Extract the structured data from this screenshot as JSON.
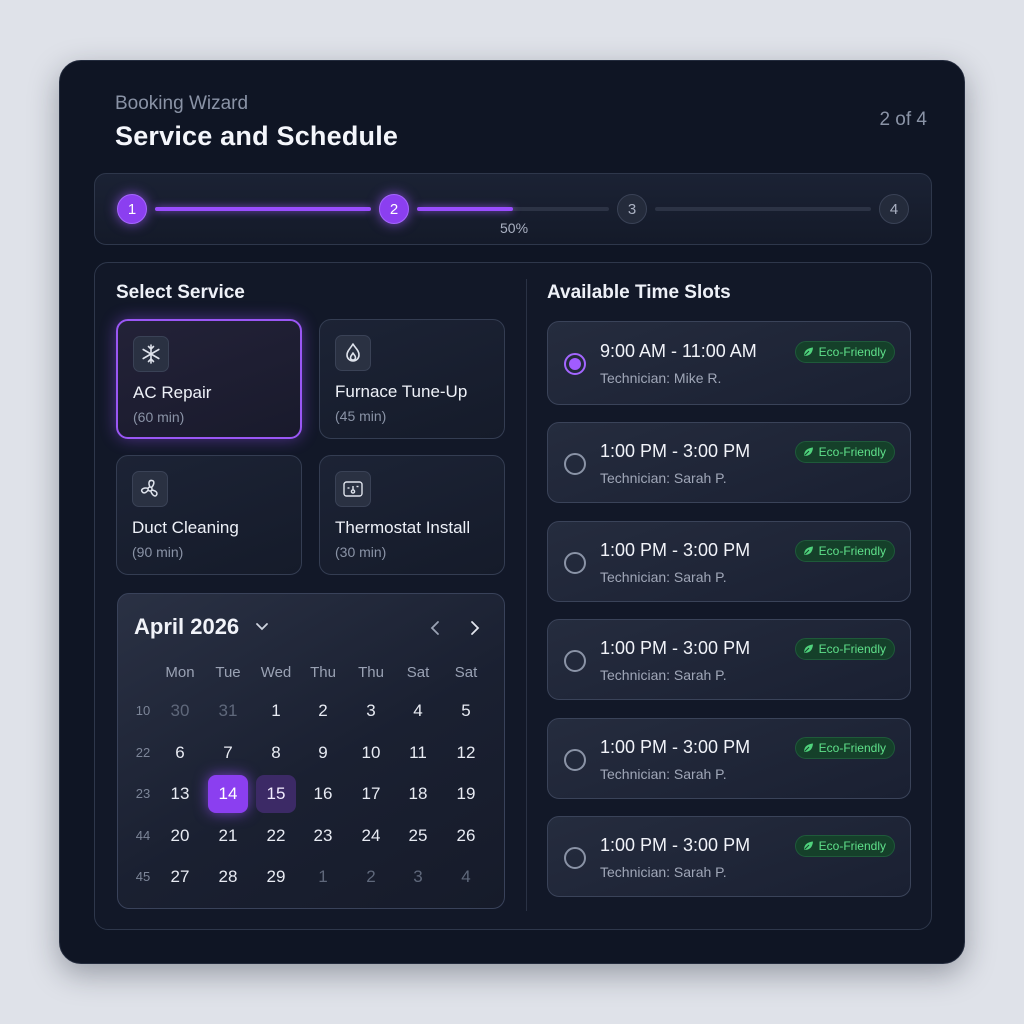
{
  "header": {
    "subtitle": "Booking Wizard",
    "title": "Service and Schedule",
    "step_count": "2 of 4"
  },
  "progress": {
    "steps": [
      "1",
      "2",
      "3",
      "4"
    ],
    "current_step": 2,
    "percent_label": "50%",
    "percent": 50,
    "accent": "#9a4dff"
  },
  "services": {
    "heading": "Select Service",
    "items": [
      {
        "icon": "snowflake-icon",
        "name": "AC Repair",
        "duration": "(60 min)",
        "selected": true
      },
      {
        "icon": "flame-icon",
        "name": "Furnace Tune-Up",
        "duration": "(45 min)",
        "selected": false
      },
      {
        "icon": "fan-icon",
        "name": "Duct Cleaning",
        "duration": "(90 min)",
        "selected": false
      },
      {
        "icon": "thermostat-icon",
        "name": "Thermostat Install",
        "duration": "(30 min)",
        "selected": false
      }
    ]
  },
  "calendar": {
    "month": "April 2026",
    "weekdays": [
      "Mon",
      "Tue",
      "Wed",
      "Thu",
      "Thu",
      "Sat",
      "Sat"
    ],
    "weeks": [
      {
        "num": "10",
        "days": [
          "30",
          "31",
          "1",
          "2",
          "3",
          "4",
          "5"
        ]
      },
      {
        "num": "22",
        "days": [
          "6",
          "7",
          "8",
          "9",
          "10",
          "11",
          "12"
        ]
      },
      {
        "num": "23",
        "days": [
          "13",
          "14",
          "15",
          "16",
          "17",
          "18",
          "19"
        ]
      },
      {
        "num": "44",
        "days": [
          "20",
          "21",
          "22",
          "23",
          "24",
          "25",
          "26"
        ]
      },
      {
        "num": "45",
        "days": [
          "27",
          "28",
          "29",
          "1",
          "2",
          "3",
          "4"
        ]
      }
    ],
    "selected_day": "14",
    "range_day": "15"
  },
  "slots": {
    "heading": "Available Time Slots",
    "badge_label": "Eco-Friendly",
    "items": [
      {
        "time": "9:00 AM - 11:00 AM",
        "tech": "Technician: Mike R.",
        "selected": true
      },
      {
        "time": "1:00 PM - 3:00 PM",
        "tech": "Technician: Sarah P.",
        "selected": false
      },
      {
        "time": "1:00 PM - 3:00 PM",
        "tech": "Technician: Sarah P.",
        "selected": false
      },
      {
        "time": "1:00 PM - 3:00 PM",
        "tech": "Technician: Sarah P.",
        "selected": false
      },
      {
        "time": "1:00 PM - 3:00 PM",
        "tech": "Technician: Sarah P.",
        "selected": false
      },
      {
        "time": "1:00 PM - 3:00 PM",
        "tech": "Technician: Sarah P.",
        "selected": false
      }
    ]
  }
}
